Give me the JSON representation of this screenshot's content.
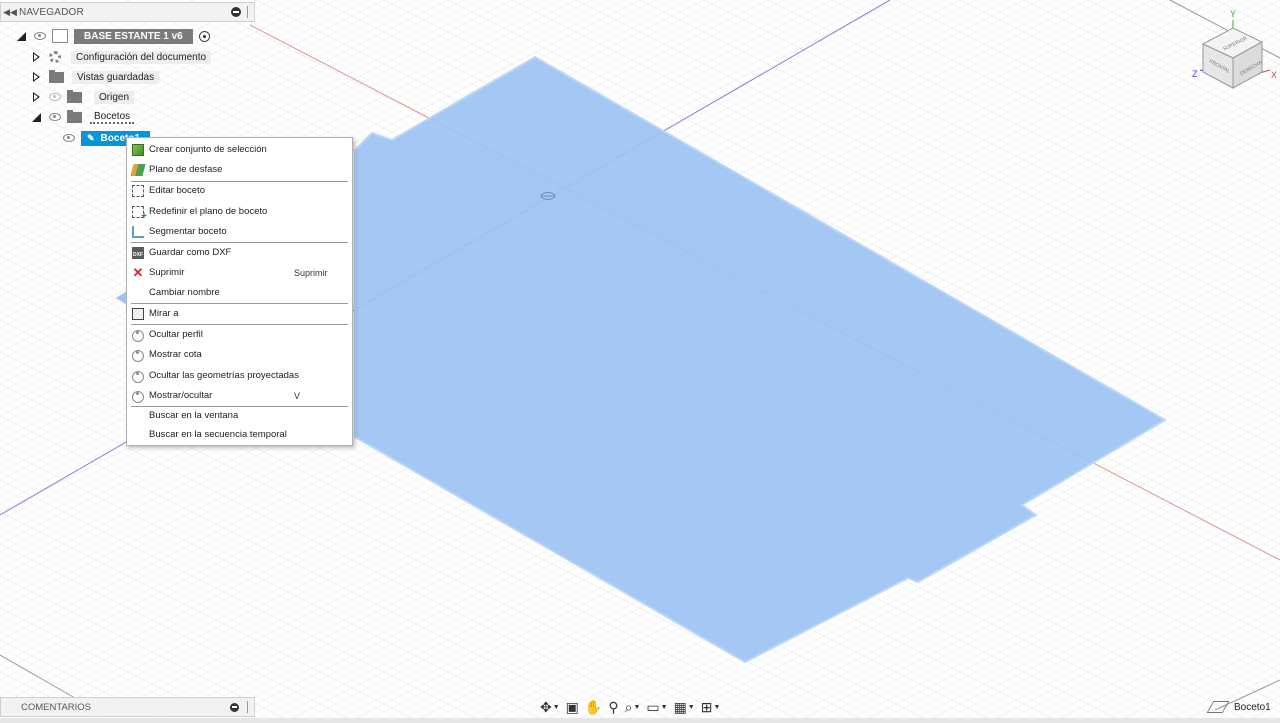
{
  "navigator": {
    "title": "NAVEGADOR",
    "root": {
      "label": "BASE ESTANTE 1 v6"
    },
    "items": [
      {
        "label": "Configuración del documento",
        "icon": "gear-icon"
      },
      {
        "label": "Vistas guardadas",
        "icon": "folder-icon"
      },
      {
        "label": "Origen",
        "icon": "folder-icon"
      },
      {
        "label": "Bocetos",
        "icon": "folder-icon"
      }
    ],
    "selected_sketch": "Boceto1"
  },
  "context_menu": {
    "items": [
      {
        "label": "Crear conjunto de selección",
        "icon": "selection-set-icon",
        "shortcut": ""
      },
      {
        "label": "Plano de desfase",
        "icon": "offset-plane-icon",
        "shortcut": ""
      },
      {
        "label": "Editar boceto",
        "icon": "edit-sketch-icon",
        "shortcut": ""
      },
      {
        "label": "Redefinir el plano de boceto",
        "icon": "redefine-plane-icon",
        "shortcut": ""
      },
      {
        "label": "Segmentar boceto",
        "icon": "slice-sketch-icon",
        "shortcut": ""
      },
      {
        "label": "Guardar como DXF",
        "icon": "dxf-icon",
        "shortcut": ""
      },
      {
        "label": "Suprimir",
        "icon": "delete-icon",
        "shortcut": "Suprimir"
      },
      {
        "label": "Cambiar nombre",
        "icon": "",
        "shortcut": ""
      },
      {
        "label": "Mirar a",
        "icon": "look-at-icon",
        "shortcut": ""
      },
      {
        "label": "Ocultar perfil",
        "icon": "eye-icon",
        "shortcut": ""
      },
      {
        "label": "Mostrar cota",
        "icon": "eye-icon",
        "shortcut": ""
      },
      {
        "label": "Ocultar las geometrías proyectadas",
        "icon": "eye-icon",
        "shortcut": ""
      },
      {
        "label": "Mostrar/ocultar",
        "icon": "eye-icon",
        "shortcut": "V"
      },
      {
        "label": "Buscar en la ventana",
        "icon": "",
        "shortcut": ""
      },
      {
        "label": "Buscar en la secuencia temporal",
        "icon": "",
        "shortcut": ""
      }
    ]
  },
  "viewcube": {
    "axes": {
      "y": "Y",
      "x": "X",
      "z": "Z"
    },
    "faces": {
      "top": "SUPERIOR",
      "front": "FRONTAL",
      "right": "DERECHA"
    }
  },
  "comments": {
    "title": "COMENTARIOS"
  },
  "active_sketch_label": "Boceto1",
  "colors": {
    "sketch_fill": "#9cc2f2",
    "sketch_edge": "#b8d4f6",
    "selection": "#0696d7",
    "axis_red": "#e05555",
    "axis_blue": "#5555e0"
  }
}
